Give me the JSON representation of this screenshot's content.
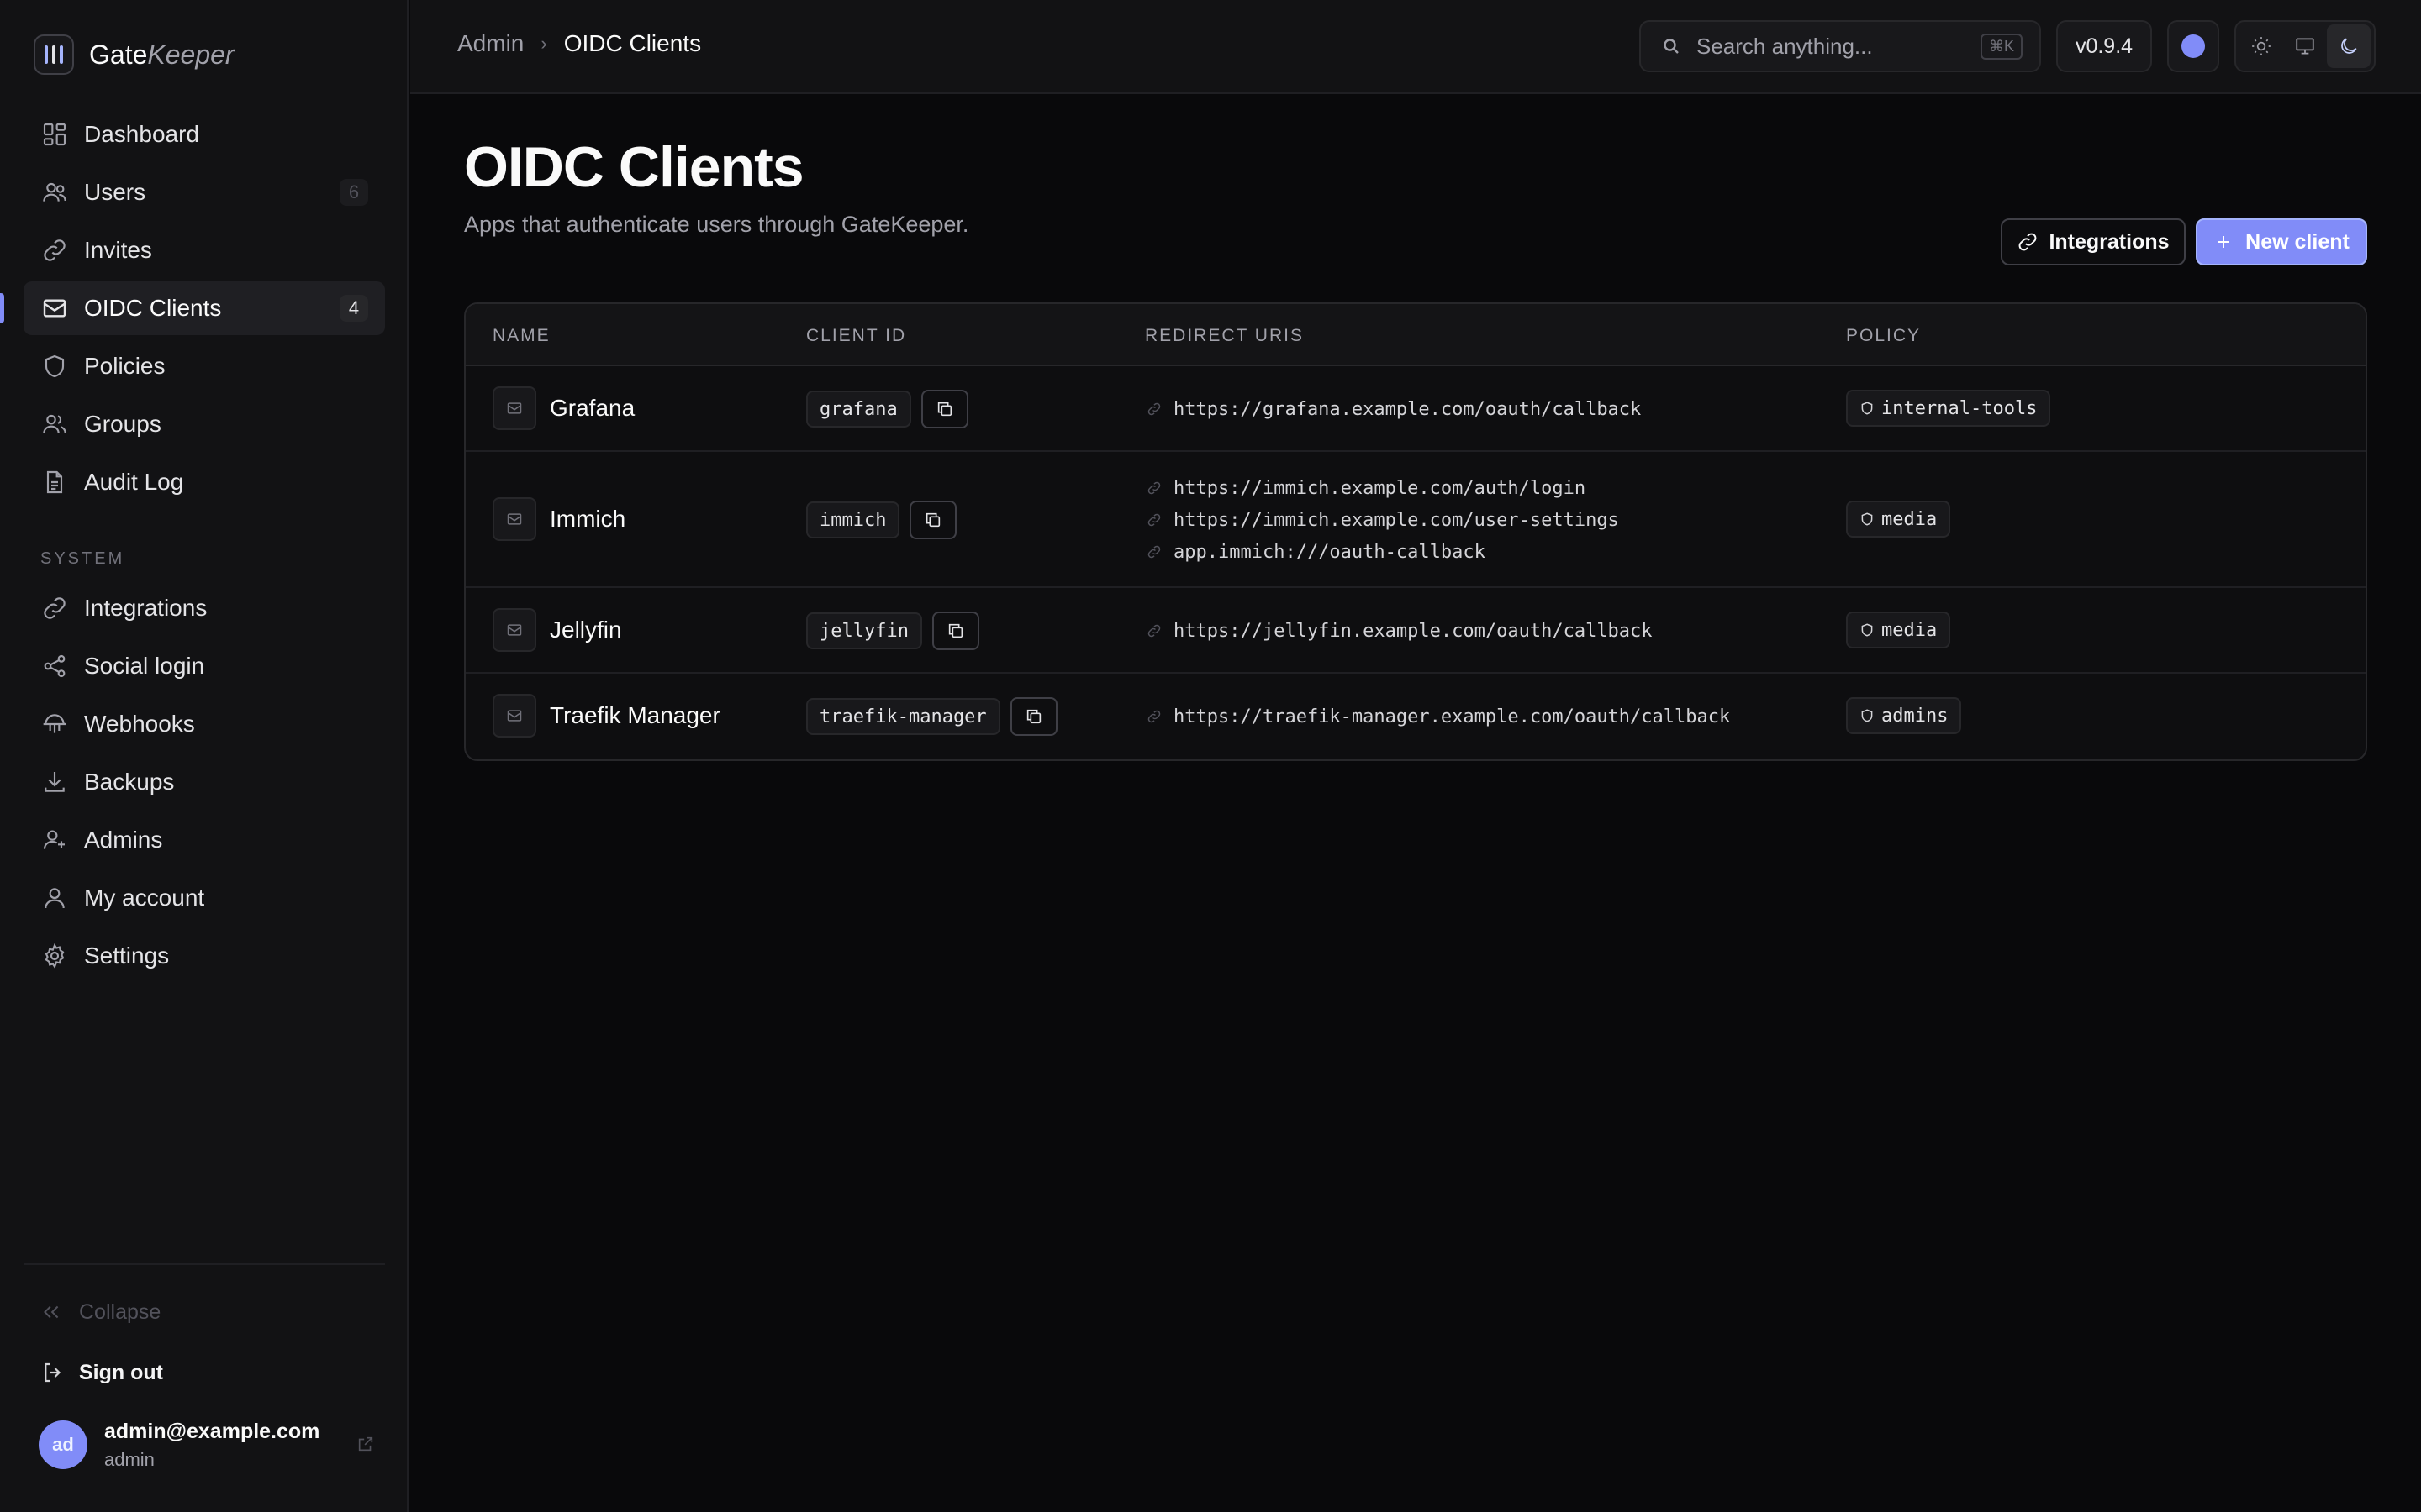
{
  "brand": {
    "part1": "Gate",
    "part2": "Keeper"
  },
  "sidebar": {
    "main_items": [
      {
        "label": "Dashboard",
        "icon": "dashboard-icon",
        "badge": ""
      },
      {
        "label": "Users",
        "icon": "users-icon",
        "badge": "6"
      },
      {
        "label": "Invites",
        "icon": "link-icon",
        "badge": ""
      },
      {
        "label": "OIDC Clients",
        "icon": "mail-icon",
        "badge": "4",
        "active": true
      },
      {
        "label": "Policies",
        "icon": "shield-icon",
        "badge": ""
      },
      {
        "label": "Groups",
        "icon": "groups-icon",
        "badge": ""
      },
      {
        "label": "Audit Log",
        "icon": "document-icon",
        "badge": ""
      }
    ],
    "section_label": "SYSTEM",
    "system_items": [
      {
        "label": "Integrations",
        "icon": "link-icon"
      },
      {
        "label": "Social login",
        "icon": "share-icon"
      },
      {
        "label": "Webhooks",
        "icon": "webhook-icon"
      },
      {
        "label": "Backups",
        "icon": "download-icon"
      },
      {
        "label": "Admins",
        "icon": "admin-icon"
      },
      {
        "label": "My account",
        "icon": "user-icon"
      },
      {
        "label": "Settings",
        "icon": "gear-icon"
      }
    ],
    "collapse_label": "Collapse",
    "signout_label": "Sign out",
    "user": {
      "initials": "ad",
      "email": "admin@example.com",
      "role": "admin"
    }
  },
  "topbar": {
    "breadcrumb": [
      "Admin",
      "OIDC Clients"
    ],
    "search_placeholder": "Search anything...",
    "search_shortcut": "⌘K",
    "version": "v0.9.4",
    "accent_color": "#818cf8",
    "theme_options": [
      "light",
      "system",
      "dark"
    ],
    "theme_selected": "dark"
  },
  "page": {
    "title": "OIDC Clients",
    "subtitle": "Apps that authenticate users through GateKeeper.",
    "integrations_label": "Integrations",
    "new_client_label": "New client"
  },
  "table": {
    "headers": [
      "NAME",
      "CLIENT ID",
      "REDIRECT URIS",
      "POLICY"
    ],
    "rows": [
      {
        "name": "Grafana",
        "client_id": "grafana",
        "redirect_uris": [
          "https://grafana.example.com/oauth/callback"
        ],
        "policy": "internal-tools"
      },
      {
        "name": "Immich",
        "client_id": "immich",
        "redirect_uris": [
          "https://immich.example.com/auth/login",
          "https://immich.example.com/user-settings",
          "app.immich:///oauth-callback"
        ],
        "policy": "media"
      },
      {
        "name": "Jellyfin",
        "client_id": "jellyfin",
        "redirect_uris": [
          "https://jellyfin.example.com/oauth/callback"
        ],
        "policy": "media"
      },
      {
        "name": "Traefik Manager",
        "client_id": "traefik-manager",
        "redirect_uris": [
          "https://traefik-manager.example.com/oauth/callback"
        ],
        "policy": "admins"
      }
    ]
  }
}
